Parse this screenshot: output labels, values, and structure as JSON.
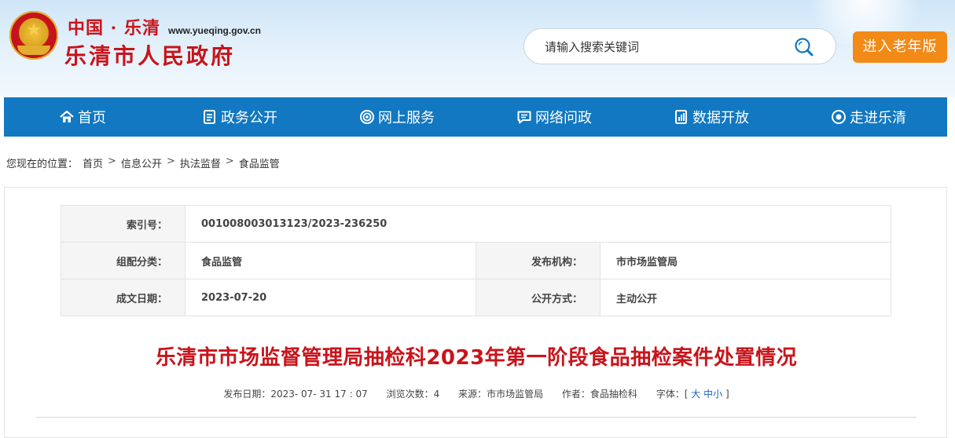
{
  "header": {
    "logo_top_text": "中国 · 乐清",
    "logo_url": "www.yueqing.gov.cn",
    "logo_name": "乐清市人民政府",
    "search_placeholder": "请输入搜索关键词",
    "elder_button_label": "进入老年版"
  },
  "nav": {
    "items": [
      {
        "label": "首页",
        "icon": "home-icon"
      },
      {
        "label": "政务公开",
        "icon": "document-icon"
      },
      {
        "label": "网上服务",
        "icon": "service-icon"
      },
      {
        "label": "网络问政",
        "icon": "message-icon"
      },
      {
        "label": "数据开放",
        "icon": "data-icon"
      },
      {
        "label": "走进乐清",
        "icon": "eye-icon"
      }
    ]
  },
  "breadcrumb": {
    "prefix": "您现在的位置：",
    "items": [
      "首页",
      "信息公开",
      "执法监督",
      "食品监管"
    ],
    "separator": ">"
  },
  "meta": {
    "index_label": "索引号：",
    "index_value": "001008003013123/2023-236250",
    "category_label": "组配分类：",
    "category_value": "食品监管",
    "publisher_label": "发布机构：",
    "publisher_value": "市市场监管局",
    "date_label": "成文日期：",
    "date_value": "2023-07-20",
    "method_label": "公开方式：",
    "method_value": "主动公开"
  },
  "article": {
    "title": "乐清市市场监督管理局抽检科2023年第一阶段食品抽检案件处置情况",
    "publish_date_label": "发布日期：",
    "publish_date": "2023- 07- 31 17 : 07",
    "views_label": "浏览次数：",
    "views": "4",
    "source_label": "来源：",
    "source": "市市场监管局",
    "author_label": "作者：",
    "author": "食品抽检科",
    "font_label": "字体：",
    "font_open": "[",
    "font_large": "大",
    "font_medium": "中",
    "font_small": "小",
    "font_close": "]"
  },
  "colors": {
    "nav_bg": "#1178c1",
    "title_red": "#c8141b",
    "elder_orange": "#f28a17"
  }
}
